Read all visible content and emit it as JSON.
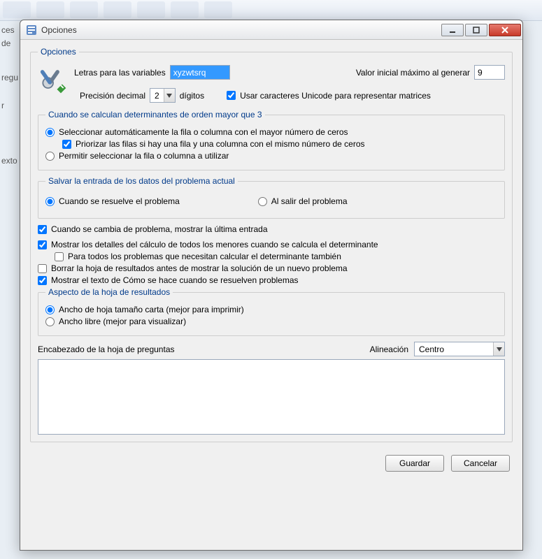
{
  "window": {
    "title": "Opciones"
  },
  "section": {
    "legend": "Opciones",
    "variables_label": "Letras para las variables",
    "variables_value": "xyzwtsrq",
    "valor_inicial_label": "Valor inicial máximo al generar",
    "valor_inicial_value": "9",
    "precision_label": "Precisión decimal",
    "precision_value": "2",
    "precision_unit": "dígitos",
    "unicode_label": "Usar caracteres Unicode para representar matrices"
  },
  "determinantes": {
    "legend": "Cuando se calculan determinantes de orden mayor que 3",
    "auto_label": "Seleccionar automáticamente la fila o columna con el mayor número de ceros",
    "priorizar_label": "Priorizar las filas si hay una fila y una columna con el mismo número de ceros",
    "permitir_label": "Permitir seleccionar la fila o columna a utilizar"
  },
  "salvar": {
    "legend": "Salvar la entrada de los datos del problema actual",
    "on_solve": "Cuando se resuelve el problema",
    "on_exit": "Al salir del problema"
  },
  "checks": {
    "cambia_problema": "Cuando se cambia de problema, mostrar la última entrada",
    "mostrar_detalles": "Mostrar los detalles del cálculo de todos los menores cuando se calcula el determinante",
    "para_todos": "Para todos los problemas que necesitan calcular el determinante también",
    "borrar_hoja": "Borrar la hoja de resultados antes de mostrar la solución de un nuevo problema",
    "mostrar_como": "Mostrar el texto de Cómo se hace cuando se resuelven problemas"
  },
  "aspecto": {
    "legend": "Aspecto de la hoja de resultados",
    "carta": "Ancho de hoja tamaño carta (mejor para imprimir)",
    "libre": "Ancho libre (mejor para visualizar)"
  },
  "encabezado": {
    "label": "Encabezado de la hoja de preguntas",
    "alineacion_label": "Alineación",
    "alineacion_value": "Centro"
  },
  "buttons": {
    "guardar": "Guardar",
    "cancelar": "Cancelar"
  },
  "bg": {
    "ces": "ces",
    "de": "de",
    "regu": "regu",
    "r": "r",
    "exto": "exto"
  }
}
